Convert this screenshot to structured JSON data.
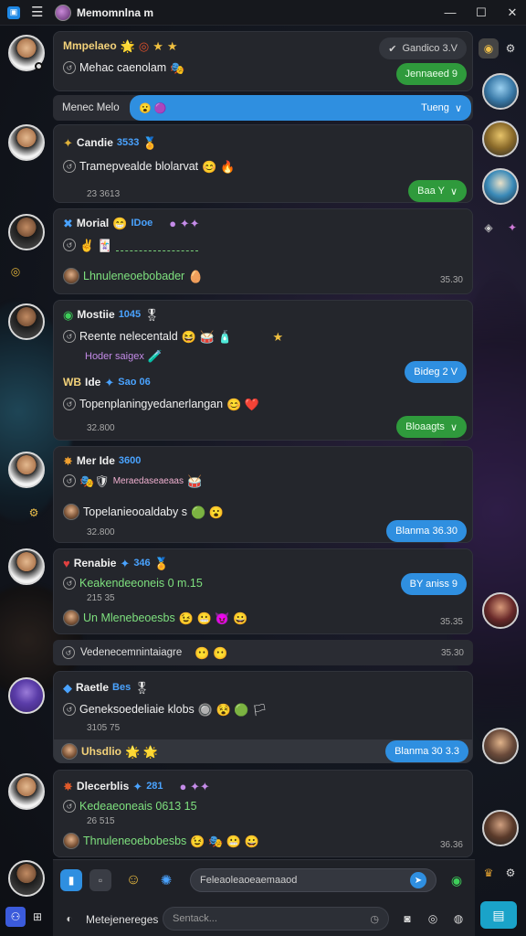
{
  "window": {
    "title": "Memomnlna m"
  },
  "messages": [
    {
      "name": "Mmpelaeo",
      "line": "Mehac caenolam",
      "pill_top": "Gandico  3.V",
      "pill_bottom": "Jennaeed 9"
    },
    {
      "strip": "Menec Melo",
      "pill": "Tueng"
    },
    {
      "name": "Candie",
      "badge": "3533",
      "line": "Tramepvealde blolarvat",
      "timestamp": "23 3613",
      "pill": "Baa Y"
    },
    {
      "name": "Morial",
      "badge": "IDoe",
      "line": "Lhnuleneoebobader",
      "timestamp": "35.30"
    },
    {
      "name": "Mostiie",
      "badge": "1045",
      "line": "Reente nelecentald",
      "sub": "Hoder saigex",
      "pill_a": "Bideg 2 V"
    },
    {
      "name": "Ide",
      "badge": "Sao 06",
      "line": "Topenplaningyedanerlangan",
      "timestamp": "32.800",
      "pill": "Bloaagts"
    },
    {
      "name": "Mer Ide",
      "badge": "3600",
      "sub": "Meraedaseaeaas",
      "line": "Topelanieooaldaby s",
      "timestamp": "32.800",
      "pill": "Blanma 36.30"
    },
    {
      "name": "Renabie",
      "badge": "346",
      "line": "Keakendeeoneis 0 m.15",
      "timestamp": "215 35",
      "line2": "Un Mlenebeoesbs",
      "timestamp2": "35.35",
      "pill": "BY aniss 9"
    },
    {
      "strip": "Vedenecemnintaiagre",
      "timestamp": "35.30"
    },
    {
      "name": "Raetle",
      "badge": "Bes",
      "line": "Geneksoedeliaie klobs",
      "timestamp": "3105 75",
      "strip_name": "Uhsdlio",
      "pill": "Blanma 30 3.3"
    },
    {
      "name": "Dlecerblis",
      "badge": "281",
      "line": "Kedeaeoneais 0613 15",
      "timestamp": "26 515",
      "line2": "Thnuleneoebobesbs",
      "timestamp2": "36.36"
    }
  ],
  "composer": {
    "placeholder": "Feleaoleaoeaemaaod",
    "search_placeholder": "Sentack...",
    "label": "Metejenereges"
  }
}
